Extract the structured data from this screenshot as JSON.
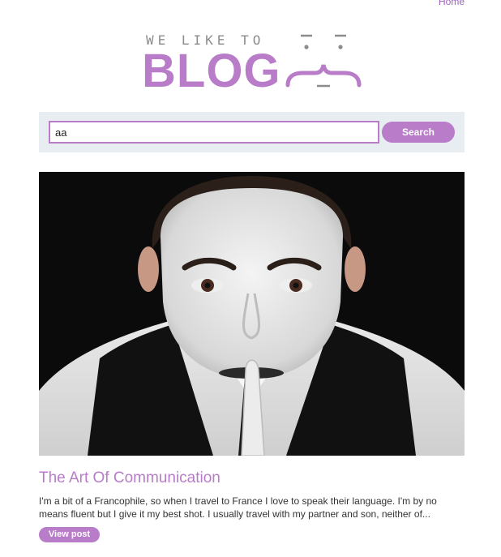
{
  "nav": {
    "home_label": "Home"
  },
  "logo": {
    "tagline": "WE LIKE TO",
    "word": "BLOG"
  },
  "search": {
    "value": "aa",
    "button_label": "Search"
  },
  "post": {
    "image_icon": "mime-shushing-photo",
    "title": "The Art Of Communication",
    "excerpt": "I'm a bit of a Francophile, so when I travel to France I love to speak their language. I'm by no means fluent but I give it my best shot. I usually travel with my partner and son, neither of...",
    "button_label": "View post"
  },
  "colors": {
    "accent": "#b87cc8",
    "search_bg": "#e8edf1",
    "link": "#a060c0"
  }
}
